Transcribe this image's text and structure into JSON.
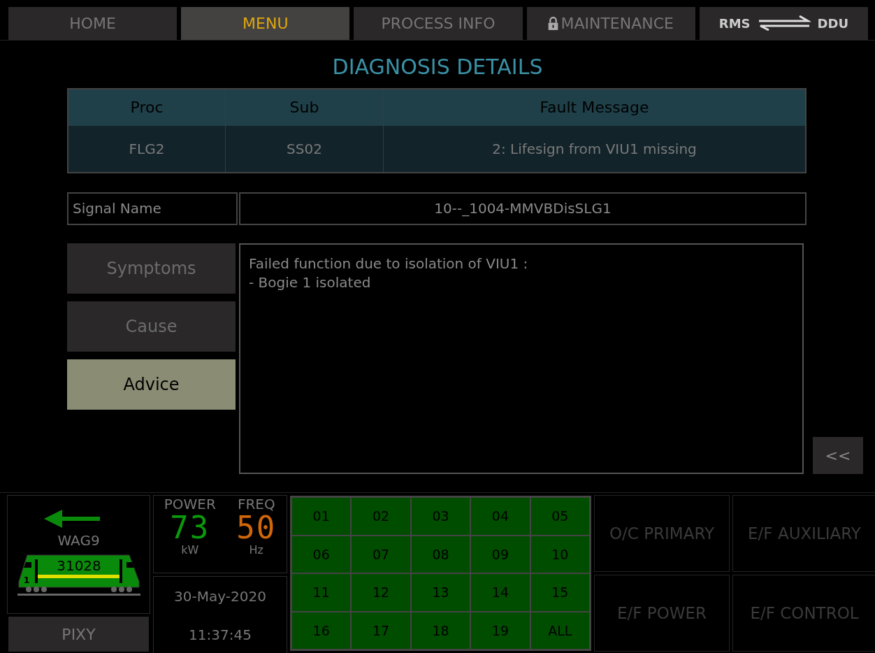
{
  "nav": [
    {
      "label": "HOME",
      "selected": false,
      "locked": false
    },
    {
      "label": "MENU",
      "selected": true,
      "locked": false
    },
    {
      "label": "PROCESS INFO",
      "selected": false,
      "locked": false
    },
    {
      "label": "MAINTENANCE",
      "selected": false,
      "locked": true
    }
  ],
  "link_button": {
    "left": "RMS",
    "right": "DDU"
  },
  "title": "DIAGNOSIS DETAILS",
  "table": {
    "columns": [
      "Proc",
      "Sub",
      "Fault Message"
    ],
    "rows": [
      [
        "FLG2",
        "SS02",
        "2: Lifesign from VIU1 missing"
      ]
    ]
  },
  "signal": {
    "label": "Signal Name",
    "value": "10--_1004-MMVBDisSLG1"
  },
  "tabs": [
    {
      "label": "Symptoms",
      "selected": false
    },
    {
      "label": "Cause",
      "selected": false
    },
    {
      "label": "Advice",
      "selected": true
    }
  ],
  "detail_text": [
    "Failed function due to isolation of VIU1 :",
    "- Bogie 1 isolated"
  ],
  "back_button": "<<",
  "locomotive": {
    "type": "WAG9",
    "number": "31028",
    "cab": "1"
  },
  "pixy_button": "PIXY",
  "power": {
    "label": "POWER",
    "value": "73",
    "unit": "kW"
  },
  "freq": {
    "label": "FREQ",
    "value": "50",
    "unit": "Hz"
  },
  "date": "30-May-2020",
  "time": "11:37:45",
  "grid": [
    "01",
    "02",
    "03",
    "04",
    "05",
    "06",
    "07",
    "08",
    "09",
    "10",
    "11",
    "12",
    "13",
    "14",
    "15",
    "16",
    "17",
    "18",
    "19",
    "ALL"
  ],
  "fault_buttons": [
    "O/C PRIMARY",
    "E/F AUXILIARY",
    "E/F POWER",
    "E/F CONTROL"
  ]
}
